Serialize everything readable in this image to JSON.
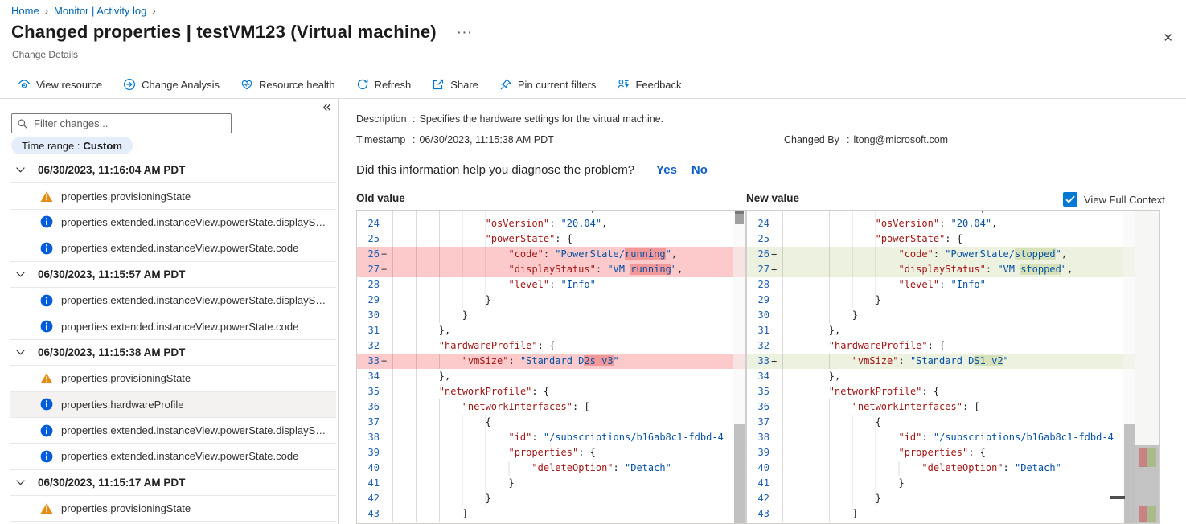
{
  "breadcrumb": {
    "items": [
      "Home",
      "Monitor | Activity log"
    ],
    "separator": "›"
  },
  "header": {
    "title": "Changed properties | testVM123 (Virtual machine)",
    "subtitle": "Change Details",
    "more_icon": "···",
    "close_icon": "✕"
  },
  "toolbar": {
    "items": [
      {
        "label": "View resource",
        "icon": "view-resource"
      },
      {
        "label": "Change Analysis",
        "icon": "change-analysis"
      },
      {
        "label": "Resource health",
        "icon": "resource-health"
      },
      {
        "label": "Refresh",
        "icon": "refresh"
      },
      {
        "label": "Share",
        "icon": "share"
      },
      {
        "label": "Pin current filters",
        "icon": "pin"
      },
      {
        "label": "Feedback",
        "icon": "feedback"
      }
    ]
  },
  "sidebar": {
    "collapse_icon": "«",
    "filter_placeholder": "Filter changes...",
    "time_range_label": "Time range :",
    "time_range_value": "Custom",
    "groups": [
      {
        "timestamp": "06/30/2023, 11:16:04 AM PDT",
        "items": [
          {
            "icon": "warning",
            "label": "properties.provisioningState",
            "selected": false
          },
          {
            "icon": "info",
            "label": "properties.extended.instanceView.powerState.displaySta...",
            "selected": false
          },
          {
            "icon": "info",
            "label": "properties.extended.instanceView.powerState.code",
            "selected": false
          }
        ]
      },
      {
        "timestamp": "06/30/2023, 11:15:57 AM PDT",
        "items": [
          {
            "icon": "info",
            "label": "properties.extended.instanceView.powerState.displaySta...",
            "selected": false
          },
          {
            "icon": "info",
            "label": "properties.extended.instanceView.powerState.code",
            "selected": false
          }
        ]
      },
      {
        "timestamp": "06/30/2023, 11:15:38 AM PDT",
        "items": [
          {
            "icon": "warning",
            "label": "properties.provisioningState",
            "selected": false
          },
          {
            "icon": "info",
            "label": "properties.hardwareProfile",
            "selected": true
          },
          {
            "icon": "info",
            "label": "properties.extended.instanceView.powerState.displaySta...",
            "selected": false
          },
          {
            "icon": "info",
            "label": "properties.extended.instanceView.powerState.code",
            "selected": false
          }
        ]
      },
      {
        "timestamp": "06/30/2023, 11:15:17 AM PDT",
        "items": [
          {
            "icon": "warning",
            "label": "properties.provisioningState",
            "selected": false
          }
        ]
      }
    ]
  },
  "details": {
    "separator": ":",
    "description_label": "Description",
    "description_value": "Specifies the hardware settings for the virtual machine.",
    "timestamp_label": "Timestamp",
    "timestamp_value": "06/30/2023, 11:15:38 AM PDT",
    "changed_by_label": "Changed By",
    "changed_by_value": "ltong@microsoft.com",
    "question": "Did this information help you diagnose the problem?",
    "yes_label": "Yes",
    "no_label": "No"
  },
  "diff": {
    "old_label": "Old value",
    "new_label": "New value",
    "context_label": "View Full Context",
    "context_checked": true,
    "colors": {
      "accent": "#0078d4",
      "json_key": "#a31515",
      "json_value": "#0451a5",
      "deleted_line_bg": "#fccaca",
      "deleted_char_bg": "#f29898",
      "added_line_bg": "#edf1e0",
      "added_char_bg": "#d7e2bb"
    },
    "old_lines": [
      {
        "n": "",
        "s": "",
        "i": 16,
        "c": "",
        "t": [
          [
            "k",
            "\"osName\""
          ],
          [
            "p",
            ": "
          ],
          [
            "v",
            "\"ubuntu\""
          ],
          [
            "p",
            ","
          ]
        ]
      },
      {
        "n": "24",
        "s": "",
        "i": 16,
        "c": "",
        "t": [
          [
            "k",
            "\"osVersion\""
          ],
          [
            "p",
            ": "
          ],
          [
            "v",
            "\"20.04\""
          ],
          [
            "p",
            ","
          ]
        ]
      },
      {
        "n": "25",
        "s": "",
        "i": 16,
        "c": "",
        "t": [
          [
            "k",
            "\"powerState\""
          ],
          [
            "p",
            ": {"
          ]
        ]
      },
      {
        "n": "26",
        "s": "−",
        "i": 20,
        "c": "del",
        "t": [
          [
            "k",
            "\"code\""
          ],
          [
            "p",
            ": "
          ],
          [
            "v",
            "\"PowerState/"
          ],
          [
            "vm",
            "running"
          ],
          [
            "v",
            "\""
          ],
          [
            "p",
            ","
          ]
        ]
      },
      {
        "n": "27",
        "s": "−",
        "i": 20,
        "c": "del",
        "t": [
          [
            "k",
            "\"displayStatus\""
          ],
          [
            "p",
            ": "
          ],
          [
            "v",
            "\"VM "
          ],
          [
            "vm",
            "running"
          ],
          [
            "v",
            "\""
          ],
          [
            "p",
            ","
          ]
        ]
      },
      {
        "n": "28",
        "s": "",
        "i": 20,
        "c": "",
        "t": [
          [
            "k",
            "\"level\""
          ],
          [
            "p",
            ": "
          ],
          [
            "v",
            "\"Info\""
          ]
        ]
      },
      {
        "n": "29",
        "s": "",
        "i": 16,
        "c": "",
        "t": [
          [
            "p",
            "}"
          ]
        ]
      },
      {
        "n": "30",
        "s": "",
        "i": 12,
        "c": "",
        "t": [
          [
            "p",
            "}"
          ]
        ]
      },
      {
        "n": "31",
        "s": "",
        "i": 8,
        "c": "",
        "t": [
          [
            "p",
            "},"
          ]
        ]
      },
      {
        "n": "32",
        "s": "",
        "i": 8,
        "c": "",
        "t": [
          [
            "k",
            "\"hardwareProfile\""
          ],
          [
            "p",
            ": {"
          ]
        ]
      },
      {
        "n": "33",
        "s": "−",
        "i": 12,
        "c": "del",
        "t": [
          [
            "k",
            "\"vmSize\""
          ],
          [
            "p",
            ": "
          ],
          [
            "v",
            "\"Standard_D"
          ],
          [
            "vm",
            "2s_v3"
          ],
          [
            "v",
            "\""
          ]
        ]
      },
      {
        "n": "34",
        "s": "",
        "i": 8,
        "c": "",
        "t": [
          [
            "p",
            "},"
          ]
        ]
      },
      {
        "n": "35",
        "s": "",
        "i": 8,
        "c": "",
        "t": [
          [
            "k",
            "\"networkProfile\""
          ],
          [
            "p",
            ": {"
          ]
        ]
      },
      {
        "n": "36",
        "s": "",
        "i": 12,
        "c": "",
        "t": [
          [
            "k",
            "\"networkInterfaces\""
          ],
          [
            "p",
            ": ["
          ]
        ]
      },
      {
        "n": "37",
        "s": "",
        "i": 16,
        "c": "",
        "t": [
          [
            "p",
            "{"
          ]
        ]
      },
      {
        "n": "38",
        "s": "",
        "i": 20,
        "c": "",
        "t": [
          [
            "k",
            "\"id\""
          ],
          [
            "p",
            ": "
          ],
          [
            "v",
            "\"/subscriptions/b16ab8c1-fdbd-4"
          ]
        ]
      },
      {
        "n": "39",
        "s": "",
        "i": 20,
        "c": "",
        "t": [
          [
            "k",
            "\"properties\""
          ],
          [
            "p",
            ": {"
          ]
        ]
      },
      {
        "n": "40",
        "s": "",
        "i": 24,
        "c": "",
        "t": [
          [
            "k",
            "\"deleteOption\""
          ],
          [
            "p",
            ": "
          ],
          [
            "v",
            "\"Detach\""
          ]
        ]
      },
      {
        "n": "41",
        "s": "",
        "i": 20,
        "c": "",
        "t": [
          [
            "p",
            "}"
          ]
        ]
      },
      {
        "n": "42",
        "s": "",
        "i": 16,
        "c": "",
        "t": [
          [
            "p",
            "}"
          ]
        ]
      },
      {
        "n": "43",
        "s": "",
        "i": 12,
        "c": "",
        "t": [
          [
            "p",
            "]"
          ]
        ]
      }
    ],
    "new_lines": [
      {
        "n": "",
        "s": "",
        "i": 16,
        "c": "",
        "t": [
          [
            "k",
            "\"osName\""
          ],
          [
            "p",
            ": "
          ],
          [
            "v",
            "\"ubuntu\""
          ],
          [
            "p",
            ","
          ]
        ]
      },
      {
        "n": "24",
        "s": "",
        "i": 16,
        "c": "",
        "t": [
          [
            "k",
            "\"osVersion\""
          ],
          [
            "p",
            ": "
          ],
          [
            "v",
            "\"20.04\""
          ],
          [
            "p",
            ","
          ]
        ]
      },
      {
        "n": "25",
        "s": "",
        "i": 16,
        "c": "",
        "t": [
          [
            "k",
            "\"powerState\""
          ],
          [
            "p",
            ": {"
          ]
        ]
      },
      {
        "n": "26",
        "s": "+",
        "i": 20,
        "c": "add",
        "t": [
          [
            "k",
            "\"code\""
          ],
          [
            "p",
            ": "
          ],
          [
            "v",
            "\"PowerState/"
          ],
          [
            "vm",
            "stopped"
          ],
          [
            "v",
            "\""
          ],
          [
            "p",
            ","
          ]
        ]
      },
      {
        "n": "27",
        "s": "+",
        "i": 20,
        "c": "add",
        "t": [
          [
            "k",
            "\"displayStatus\""
          ],
          [
            "p",
            ": "
          ],
          [
            "v",
            "\"VM "
          ],
          [
            "vm",
            "stopped"
          ],
          [
            "v",
            "\""
          ],
          [
            "p",
            ","
          ]
        ]
      },
      {
        "n": "28",
        "s": "",
        "i": 20,
        "c": "",
        "t": [
          [
            "k",
            "\"level\""
          ],
          [
            "p",
            ": "
          ],
          [
            "v",
            "\"Info\""
          ]
        ]
      },
      {
        "n": "29",
        "s": "",
        "i": 16,
        "c": "",
        "t": [
          [
            "p",
            "}"
          ]
        ]
      },
      {
        "n": "30",
        "s": "",
        "i": 12,
        "c": "",
        "t": [
          [
            "p",
            "}"
          ]
        ]
      },
      {
        "n": "31",
        "s": "",
        "i": 8,
        "c": "",
        "t": [
          [
            "p",
            "},"
          ]
        ]
      },
      {
        "n": "32",
        "s": "",
        "i": 8,
        "c": "",
        "t": [
          [
            "k",
            "\"hardwareProfile\""
          ],
          [
            "p",
            ": {"
          ]
        ]
      },
      {
        "n": "33",
        "s": "+",
        "i": 12,
        "c": "add",
        "t": [
          [
            "k",
            "\"vmSize\""
          ],
          [
            "p",
            ": "
          ],
          [
            "v",
            "\"Standard_D"
          ],
          [
            "vm",
            "S1_v2"
          ],
          [
            "v",
            "\""
          ]
        ]
      },
      {
        "n": "34",
        "s": "",
        "i": 8,
        "c": "",
        "t": [
          [
            "p",
            "},"
          ]
        ]
      },
      {
        "n": "35",
        "s": "",
        "i": 8,
        "c": "",
        "t": [
          [
            "k",
            "\"networkProfile\""
          ],
          [
            "p",
            ": {"
          ]
        ]
      },
      {
        "n": "36",
        "s": "",
        "i": 12,
        "c": "",
        "t": [
          [
            "k",
            "\"networkInterfaces\""
          ],
          [
            "p",
            ": ["
          ]
        ]
      },
      {
        "n": "37",
        "s": "",
        "i": 16,
        "c": "",
        "t": [
          [
            "p",
            "{"
          ]
        ]
      },
      {
        "n": "38",
        "s": "",
        "i": 20,
        "c": "",
        "t": [
          [
            "k",
            "\"id\""
          ],
          [
            "p",
            ": "
          ],
          [
            "v",
            "\"/subscriptions/b16ab8c1-fdbd-4"
          ]
        ]
      },
      {
        "n": "39",
        "s": "",
        "i": 20,
        "c": "",
        "t": [
          [
            "k",
            "\"properties\""
          ],
          [
            "p",
            ": {"
          ]
        ]
      },
      {
        "n": "40",
        "s": "",
        "i": 24,
        "c": "",
        "t": [
          [
            "k",
            "\"deleteOption\""
          ],
          [
            "p",
            ": "
          ],
          [
            "v",
            "\"Detach\""
          ]
        ]
      },
      {
        "n": "41",
        "s": "",
        "i": 20,
        "c": "",
        "t": [
          [
            "p",
            "}"
          ]
        ]
      },
      {
        "n": "42",
        "s": "",
        "i": 16,
        "c": "",
        "t": [
          [
            "p",
            "}"
          ]
        ]
      },
      {
        "n": "43",
        "s": "",
        "i": 12,
        "c": "",
        "t": [
          [
            "p",
            "]"
          ]
        ]
      }
    ]
  }
}
